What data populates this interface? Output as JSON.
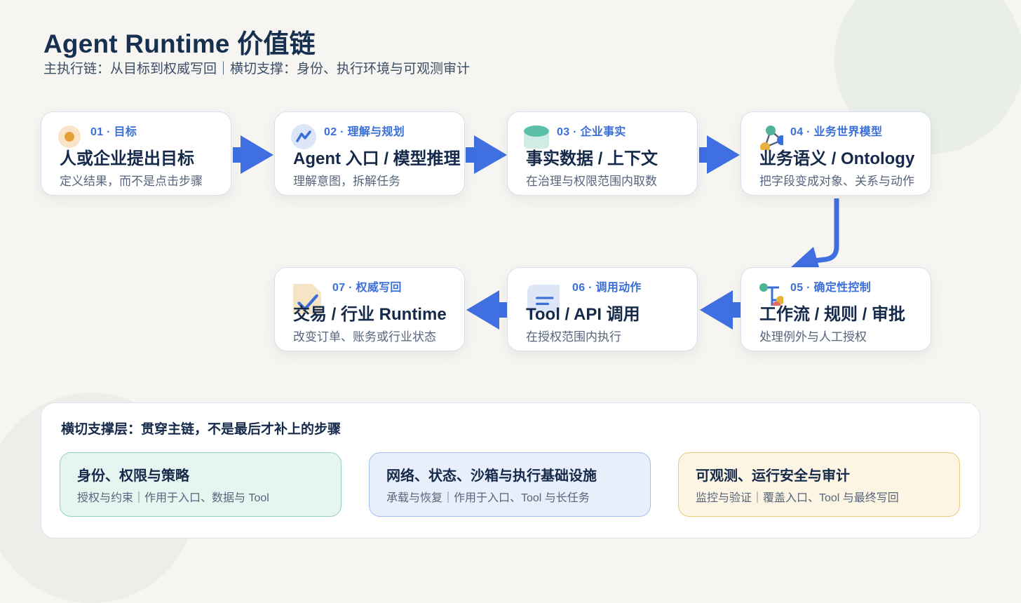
{
  "header": {
    "title": "Agent Runtime 价值链",
    "subtitle": "主执行链：从目标到权威写回｜横切支撑：身份、执行环境与可观测审计"
  },
  "steps": [
    {
      "num": "01 · 目标",
      "title": "人或企业提出目标",
      "desc": "定义结果，而不是点击步骤",
      "icon": "target-icon"
    },
    {
      "num": "02 · 理解与规划",
      "title": "Agent 入口 / 模型推理",
      "desc": "理解意图，拆解任务",
      "icon": "trend-icon"
    },
    {
      "num": "03 · 企业事实",
      "title": "事实数据 / 上下文",
      "desc": "在治理与权限范围内取数",
      "icon": "database-icon"
    },
    {
      "num": "04 · 业务世界模型",
      "title": "业务语义 / Ontology",
      "desc": "把字段变成对象、关系与动作",
      "icon": "graph-icon"
    },
    {
      "num": "05 · 确定性控制",
      "title": "工作流 / 规则 / 审批",
      "desc": "处理例外与人工授权",
      "icon": "workflow-icon"
    },
    {
      "num": "06 · 调用动作",
      "title": "Tool / API 调用",
      "desc": "在授权范围内执行",
      "icon": "tool-icon"
    },
    {
      "num": "07 · 权威写回",
      "title": "交易 / 行业 Runtime",
      "desc": "改变订单、账务或行业状态",
      "icon": "document-check-icon"
    }
  ],
  "support": {
    "heading": "横切支撑层：贯穿主链，不是最后才补上的步骤",
    "cards": [
      {
        "title": "身份、权限与策略",
        "desc": "授权与约束｜作用于入口、数据与 Tool",
        "color": "#8fd3c1"
      },
      {
        "title": "网络、状态、沙箱与执行基础设施",
        "desc": "承载与恢复｜作用于入口、Tool 与长任务",
        "color": "#a5bfea"
      },
      {
        "title": "可观测、运行安全与审计",
        "desc": "监控与验证｜覆盖入口、Tool 与最终写回",
        "color": "#ecc97a"
      }
    ]
  },
  "colors": {
    "accent": "#3b6fd8",
    "arrow": "#3f6fe0",
    "title": "#17304f"
  }
}
